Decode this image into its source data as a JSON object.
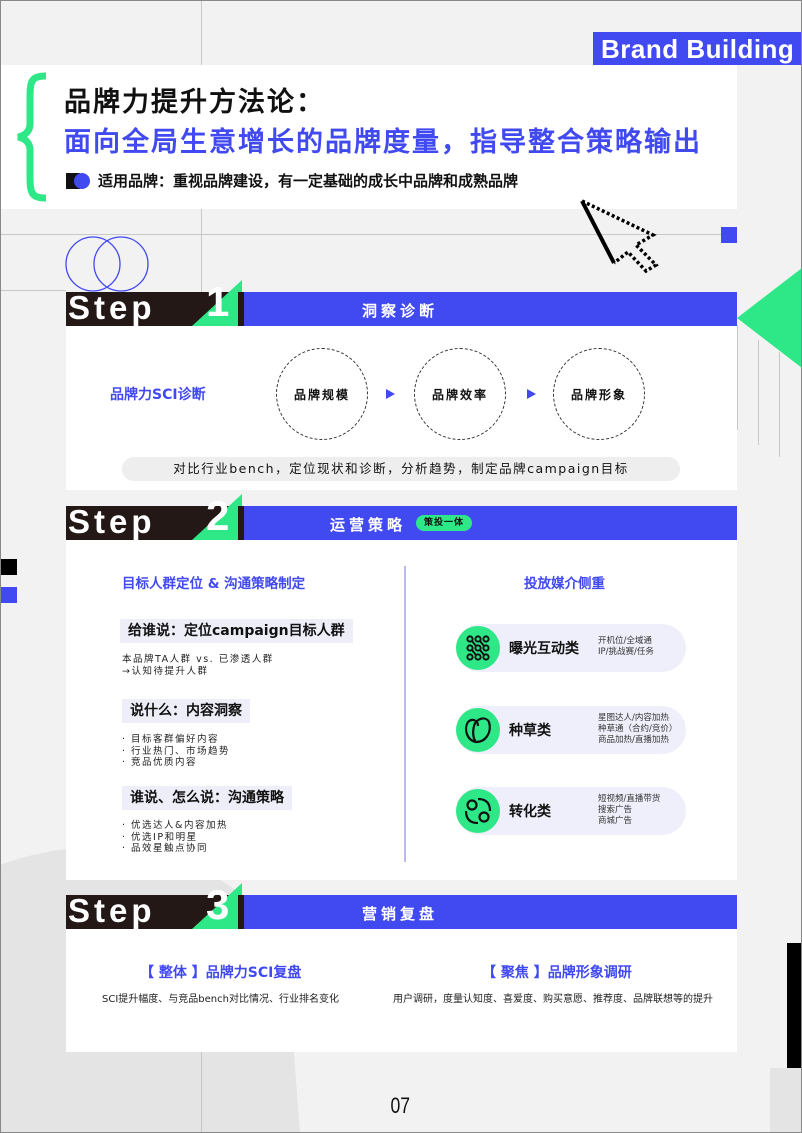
{
  "brand_tag": "Brand Building",
  "header": {
    "title_line1": "品牌力提升方法论：",
    "title_line2": "面向全局生意增长的品牌度量，指导整合策略输出",
    "applies_to": "适用品牌：重视品牌建设，有一定基础的成长中品牌和成熟品牌"
  },
  "colors": {
    "accent_blue": "#4149f0",
    "accent_green": "#2ee887",
    "dark": "#231815"
  },
  "step1": {
    "word": "Step",
    "number": "1",
    "title": "洞察诊断",
    "sci_label": "品牌力SCI诊断",
    "circles": [
      "品牌规模",
      "品牌效率",
      "品牌形象"
    ],
    "summary": "对比行业bench，定位现状和诊断，分析趋势，制定品牌campaign目标"
  },
  "step2": {
    "word": "Step",
    "number": "2",
    "title": "运营策略",
    "badge": "策投一体",
    "left_heading": "目标人群定位 & 沟通策略制定",
    "right_heading": "投放媒介侧重",
    "questions": [
      {
        "title": "给谁说：定位campaign目标人群",
        "lines": "本品牌TA人群 vs. 已渗透人群\n→认知待提升人群"
      },
      {
        "title": "说什么：内容洞察",
        "lines": "· 目标客群偏好内容\n· 行业热门、市场趋势\n· 竞品优质内容"
      },
      {
        "title": "谁说、怎么说：沟通策略",
        "lines": "· 优选达人&内容加热\n· 优选IP和明星\n· 品效星触点协同"
      }
    ],
    "media": [
      {
        "icon": "network-nodes-icon",
        "title": "曝光互动类",
        "desc": "开机位/全域通\nIP/挑战赛/任务"
      },
      {
        "icon": "leaf-seed-icon",
        "title": "种草类",
        "desc": "星图达人/内容加热\n种草通（合约/竞价）\n商品加热/直播加热"
      },
      {
        "icon": "cycle-conversion-icon",
        "title": "转化类",
        "desc": "短视频/直播带货\n搜索广告\n商城广告"
      }
    ]
  },
  "step3": {
    "word": "Step",
    "number": "3",
    "title": "营销复盘",
    "left_heading": "【 整体 】品牌力SCI复盘",
    "left_desc": "SCI提升幅度、与竞品bench对比情况、行业排名变化",
    "right_heading": "【 聚焦 】品牌形象调研",
    "right_desc": "用户调研，度量认知度、喜爱度、购买意愿、推荐度、品牌联想等的提升"
  },
  "page_number": "07"
}
